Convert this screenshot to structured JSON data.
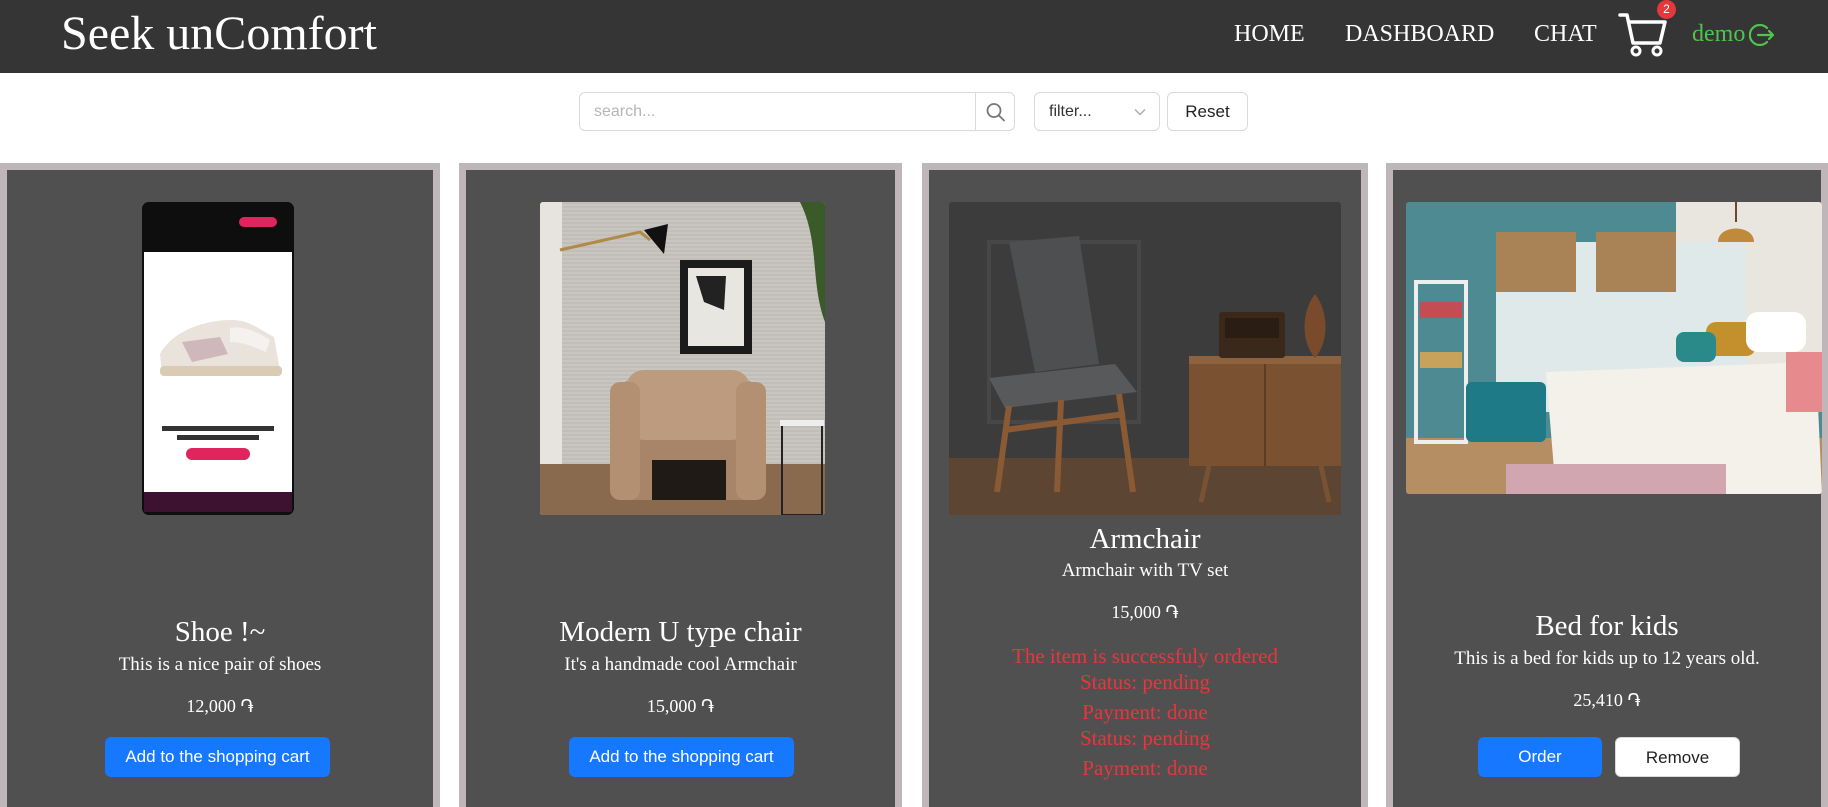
{
  "header": {
    "brand": "Seek unComfort",
    "nav": {
      "home": "HOME",
      "dashboard": "DASHBOARD",
      "chat": "CHAT"
    },
    "cart_count": "2",
    "user": "demo"
  },
  "toolbar": {
    "search_placeholder": "search...",
    "filter_label": "filter...",
    "reset_label": "Reset"
  },
  "products": [
    {
      "title": "Shoe !~",
      "description": "This is a nice pair of shoes",
      "price": "12,000 ֏",
      "action": "Add to the shopping cart",
      "image": "shoe-product-photo"
    },
    {
      "title": "Modern U type chair",
      "description": "It's a handmade cool Armchair",
      "price": "15,000 ֏",
      "action": "Add to the shopping cart",
      "image": "beige-armchair-photo"
    },
    {
      "title": "Armchair",
      "description": "Armchair with TV set",
      "price": "15,000 ֏",
      "status_lines": [
        "The item is successfuly ordered",
        "Status: pending",
        "Payment: done",
        "Status: pending",
        "Payment: done"
      ],
      "image": "grey-armchair-with-cabinet-photo"
    },
    {
      "title": "Bed for kids",
      "description": "This is a bed for kids up to 12 years old.",
      "price": "25,410 ֏",
      "order_label": "Order",
      "remove_label": "Remove",
      "image": "kids-bedroom-photo"
    }
  ],
  "colors": {
    "header_bg": "#353535",
    "card_bg": "#515050",
    "card_border": "#bfb6b9",
    "primary": "#1677ff",
    "status_red": "#e5373c",
    "user_green": "#4fc44f"
  }
}
